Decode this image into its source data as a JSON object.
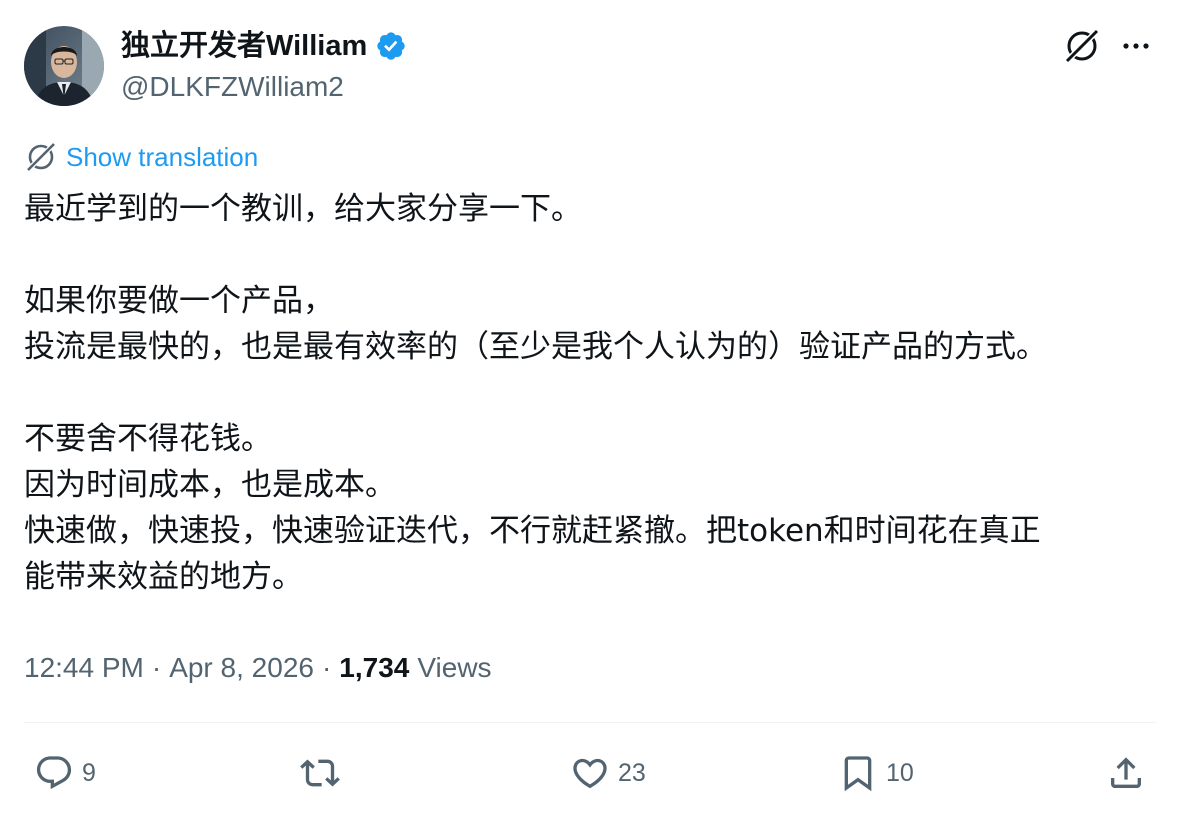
{
  "author": {
    "name": "独立开发者William",
    "handle": "@DLKFZWilliam2",
    "verified": true
  },
  "translation": {
    "label": "Show translation"
  },
  "tweet": {
    "lines": [
      "最近学到的一个教训，给大家分享一下。",
      "",
      "如果你要做一个产品，",
      "投流是最快的，也是最有效率的（至少是我个人认为的）验证产品的方式。",
      "",
      "不要舍不得花钱。",
      "因为时间成本，也是成本。",
      "快速做，快速投，快速验证迭代，不行就赶紧撤。把token和时间花在真正",
      "能带来效益的地方。"
    ]
  },
  "meta": {
    "time": "12:44 PM",
    "separator": "·",
    "date": "Apr 8, 2026",
    "views_count": "1,734",
    "views_label": "Views"
  },
  "actions": {
    "reply_count": "9",
    "repost_count": "",
    "like_count": "23",
    "bookmark_count": "10"
  },
  "colors": {
    "text": "#0f1419",
    "secondary": "#536471",
    "accent": "#1d9bf0",
    "divider": "#eff3f4"
  },
  "icons": {
    "verified": "verified-badge-icon",
    "grok": "grok-icon",
    "more": "more-icon",
    "translate": "translate-icon",
    "reply": "reply-icon",
    "repost": "repost-icon",
    "like": "heart-icon",
    "bookmark": "bookmark-icon",
    "share": "share-icon"
  }
}
